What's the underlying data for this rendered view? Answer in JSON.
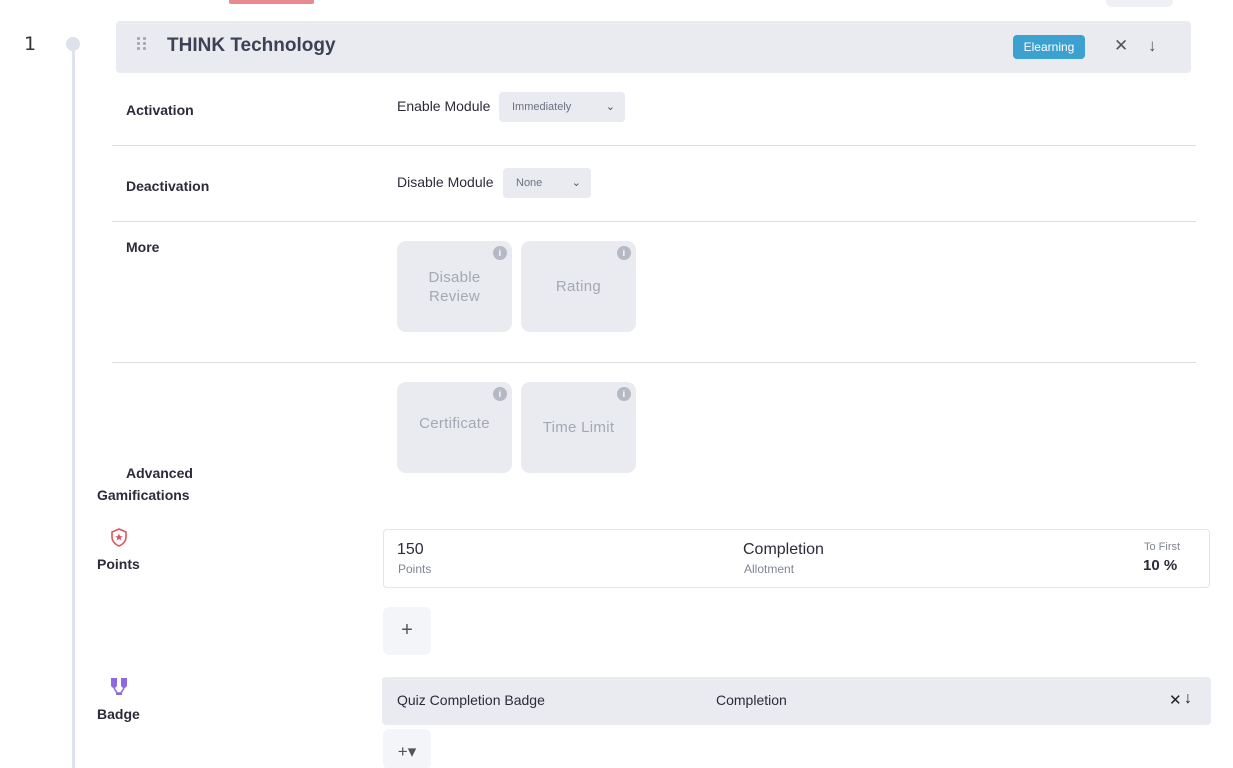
{
  "step": {
    "number": "1"
  },
  "header": {
    "title": "THINK Technology",
    "type_badge": "Elearning",
    "close_icon": "close-icon",
    "move_icon": "arrow-down-icon"
  },
  "activation": {
    "section_label": "Activation",
    "field_label": "Enable Module",
    "select_value": "Immediately"
  },
  "deactivation": {
    "section_label": "Deactivation",
    "field_label": "Disable Module",
    "select_value": "None"
  },
  "more": {
    "section_label": "More",
    "tiles": [
      {
        "label_line1": "Disable",
        "label_line2": "Review"
      },
      {
        "label_line1": "Rating",
        "label_line2": ""
      }
    ]
  },
  "advanced": {
    "section_label_line1": "Advanced",
    "section_label_line2": "Gamifications",
    "tiles": [
      {
        "label": "Certificate"
      },
      {
        "label": "Time Limit"
      }
    ]
  },
  "points": {
    "section_label": "Points",
    "icon": "star-shield-icon",
    "value": "150",
    "value_sub": "Points",
    "trigger": "Completion",
    "trigger_sub": "Allotment",
    "target_sub": "To First",
    "target_value": "10 %",
    "add_label": "+"
  },
  "badge": {
    "section_label": "Badge",
    "icon": "trophy-icon",
    "name": "Quiz Completion Badge",
    "trigger": "Completion",
    "close_label": "✕",
    "arrow_label": "↓",
    "add_label": "+▾"
  },
  "colors": {
    "accent": "#3da1cf",
    "header_bg": "#e9ebf1",
    "points_icon": "#e0545d",
    "badge_icon": "#8d6ae0"
  }
}
